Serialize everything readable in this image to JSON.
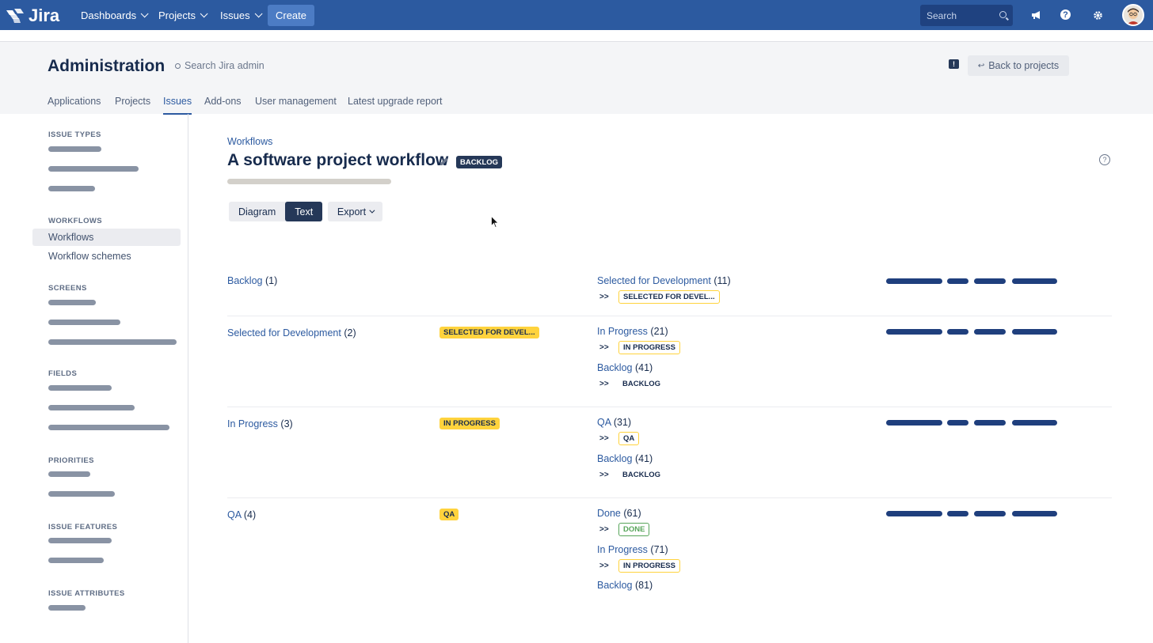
{
  "topnav": {
    "logo_text": "Jira",
    "items": [
      {
        "label": "Dashboards"
      },
      {
        "label": "Projects"
      },
      {
        "label": "Issues"
      }
    ],
    "create_label": "Create",
    "search_placeholder": "Search",
    "accent": "#2c5aa0"
  },
  "admin": {
    "title": "Administration",
    "search_placeholder": "Search Jira admin",
    "back_label": "Back to projects",
    "tabs": [
      {
        "label": "Applications"
      },
      {
        "label": "Projects"
      },
      {
        "label": "Issues"
      },
      {
        "label": "Add-ons"
      },
      {
        "label": "User management"
      },
      {
        "label": "Latest upgrade report"
      }
    ],
    "active_tab": "Issues"
  },
  "sidebar": {
    "sections": [
      {
        "heading": "ISSUE TYPES"
      },
      {
        "heading": "WORKFLOWS",
        "items": [
          {
            "label": "Workflows"
          },
          {
            "label": "Workflow schemes"
          }
        ],
        "selected": "Workflows"
      },
      {
        "heading": "SCREENS"
      },
      {
        "heading": "FIELDS"
      },
      {
        "heading": "PRIORITIES"
      },
      {
        "heading": "ISSUE FEATURES"
      },
      {
        "heading": "ISSUE ATTRIBUTES"
      }
    ]
  },
  "main": {
    "breadcrumb": "Workflows",
    "title": "A software project workflow",
    "title_lozenge": "BACKLOG",
    "view_toggle": [
      {
        "label": "Diagram"
      },
      {
        "label": "Text"
      }
    ],
    "active_view": "Text",
    "export_label": "Export",
    "rows": [
      {
        "status": {
          "name": "Backlog",
          "count": "(1)"
        },
        "lozenge": "",
        "transitions": [
          {
            "name": "Selected for Development",
            "count": "(11)",
            "target": "SELECTED FOR DEVEL...",
            "style": "outline-yellow"
          }
        ]
      },
      {
        "status": {
          "name": "Selected for Development",
          "count": "(2)"
        },
        "lozenge": "SELECTED FOR DEVEL...",
        "transitions": [
          {
            "name": "In Progress",
            "count": "(21)",
            "target": "IN PROGRESS",
            "style": "outline-yellow"
          },
          {
            "name": "Backlog",
            "count": "(41)",
            "target": "BACKLOG",
            "style": "plain"
          }
        ]
      },
      {
        "status": {
          "name": "In Progress",
          "count": "(3)"
        },
        "lozenge": "IN PROGRESS",
        "transitions": [
          {
            "name": "QA",
            "count": "(31)",
            "target": "QA",
            "style": "outline-yellow"
          },
          {
            "name": "Backlog",
            "count": "(41)",
            "target": "BACKLOG",
            "style": "plain"
          }
        ]
      },
      {
        "status": {
          "name": "QA",
          "count": "(4)"
        },
        "lozenge": "QA",
        "transitions": [
          {
            "name": "Done",
            "count": "(61)",
            "target": "DONE",
            "style": "outline-green"
          },
          {
            "name": "In Progress",
            "count": "(71)",
            "target": "IN PROGRESS",
            "style": "outline-yellow"
          },
          {
            "name": "Backlog",
            "count": "(81)",
            "target": "",
            "style": "none"
          }
        ]
      }
    ],
    "transition_marker": ">>"
  }
}
